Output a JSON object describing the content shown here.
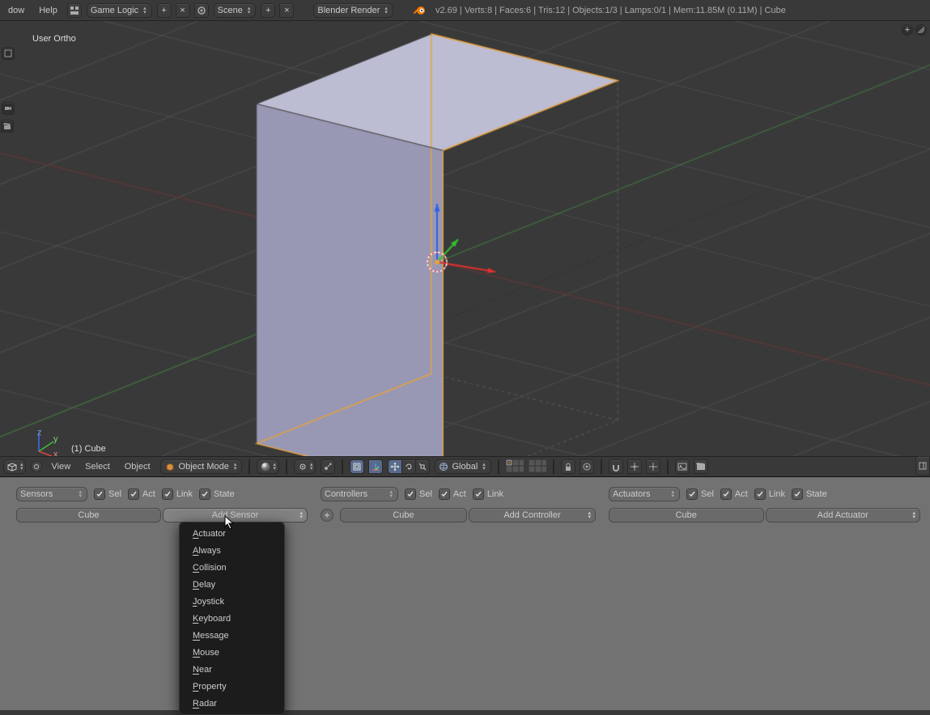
{
  "header": {
    "menu": {
      "window": "dow",
      "help": "Help"
    },
    "screen_layout": "Game Logic",
    "scene": "Scene",
    "render_engine": "Blender Render",
    "stats": "v2.69 | Verts:8 | Faces:6 | Tris:12 | Objects:1/3 | Lamps:0/1 | Mem:11.85M (0.11M) | Cube"
  },
  "viewport": {
    "persp_label": "User Ortho",
    "object_label": "(1) Cube"
  },
  "vp_footer": {
    "view": "View",
    "select": "Select",
    "object": "Object",
    "mode": "Object Mode",
    "orientation": "Global"
  },
  "logic": {
    "sensors": {
      "dropdown": "Sensors",
      "checks": {
        "sel": "Sel",
        "act": "Act",
        "link": "Link",
        "state": "State"
      },
      "object": "Cube",
      "add": "Add Sensor"
    },
    "controllers": {
      "dropdown": "Controllers",
      "checks": {
        "sel": "Sel",
        "act": "Act",
        "link": "Link"
      },
      "object": "Cube",
      "add": "Add Controller"
    },
    "actuators": {
      "dropdown": "Actuators",
      "checks": {
        "sel": "Sel",
        "act": "Act",
        "link": "Link",
        "state": "State"
      },
      "object": "Cube",
      "add": "Add Actuator"
    }
  },
  "sensor_menu": {
    "items": [
      {
        "u": "A",
        "rest": "ctuator"
      },
      {
        "u": "A",
        "rest": "lways"
      },
      {
        "u": "C",
        "rest": "ollision"
      },
      {
        "u": "D",
        "rest": "elay"
      },
      {
        "u": "J",
        "rest": "oystick"
      },
      {
        "u": "K",
        "rest": "eyboard"
      },
      {
        "u": "M",
        "rest": "essage"
      },
      {
        "u": "M",
        "rest": "ouse"
      },
      {
        "u": "N",
        "rest": "ear"
      },
      {
        "u": "P",
        "rest": "roperty"
      },
      {
        "u": "R",
        "rest": "adar"
      }
    ]
  }
}
